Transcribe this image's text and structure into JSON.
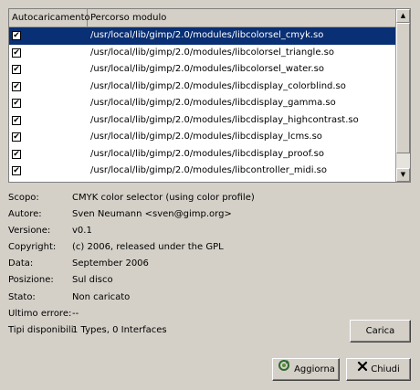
{
  "table": {
    "headers": [
      "Autocaricamento",
      "Percorso modulo"
    ],
    "rows": [
      {
        "checked": true,
        "path": "/usr/local/lib/gimp/2.0/modules/libcolorsel_cmyk.so",
        "selected": true
      },
      {
        "checked": true,
        "path": "/usr/local/lib/gimp/2.0/modules/libcolorsel_triangle.so"
      },
      {
        "checked": true,
        "path": "/usr/local/lib/gimp/2.0/modules/libcolorsel_water.so"
      },
      {
        "checked": true,
        "path": "/usr/local/lib/gimp/2.0/modules/libcdisplay_colorblind.so"
      },
      {
        "checked": true,
        "path": "/usr/local/lib/gimp/2.0/modules/libcdisplay_gamma.so"
      },
      {
        "checked": true,
        "path": "/usr/local/lib/gimp/2.0/modules/libcdisplay_highcontrast.so"
      },
      {
        "checked": true,
        "path": "/usr/local/lib/gimp/2.0/modules/libcdisplay_lcms.so"
      },
      {
        "checked": true,
        "path": "/usr/local/lib/gimp/2.0/modules/libcdisplay_proof.so"
      },
      {
        "checked": true,
        "path": "/usr/local/lib/gimp/2.0/modules/libcontroller_midi.so"
      }
    ]
  },
  "info": [
    {
      "label": "Scopo:",
      "value": "CMYK color selector (using color profile)"
    },
    {
      "label": "Autore:",
      "value": "Sven Neumann <sven@gimp.org>"
    },
    {
      "label": "Versione:",
      "value": "v0.1"
    },
    {
      "label": "Copyright:",
      "value": "(c) 2006, released under the GPL"
    },
    {
      "label": "Data:",
      "value": "September 2006"
    },
    {
      "label": "Posizione:",
      "value": "Sul disco"
    },
    {
      "label": "Stato:",
      "value": "Non caricato"
    },
    {
      "label": "Ultimo errore:",
      "value": "--"
    },
    {
      "label": "Tipi disponibili:",
      "value": "1 Types, 0 Interfaces"
    }
  ],
  "buttons": {
    "carica": "Carica",
    "aggiorna": "Aggiorna",
    "chiudi": "Chiudi"
  },
  "icons": {
    "checkbox": "checkmark-icon",
    "aggiorna": "refresh-icon",
    "chiudi": "close-icon"
  },
  "colors": {
    "selection": "#092f74",
    "background": "#d4d0c8"
  }
}
